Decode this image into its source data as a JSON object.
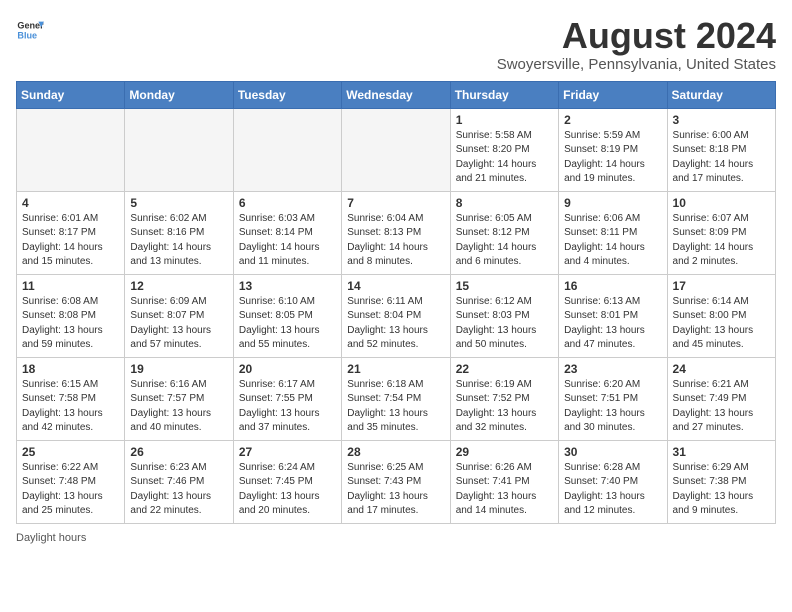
{
  "header": {
    "logo_line1": "General",
    "logo_line2": "Blue",
    "month_year": "August 2024",
    "location": "Swoyersville, Pennsylvania, United States"
  },
  "columns": [
    "Sunday",
    "Monday",
    "Tuesday",
    "Wednesday",
    "Thursday",
    "Friday",
    "Saturday"
  ],
  "weeks": [
    [
      {
        "day": "",
        "info": ""
      },
      {
        "day": "",
        "info": ""
      },
      {
        "day": "",
        "info": ""
      },
      {
        "day": "",
        "info": ""
      },
      {
        "day": "1",
        "info": "Sunrise: 5:58 AM\nSunset: 8:20 PM\nDaylight: 14 hours and 21 minutes."
      },
      {
        "day": "2",
        "info": "Sunrise: 5:59 AM\nSunset: 8:19 PM\nDaylight: 14 hours and 19 minutes."
      },
      {
        "day": "3",
        "info": "Sunrise: 6:00 AM\nSunset: 8:18 PM\nDaylight: 14 hours and 17 minutes."
      }
    ],
    [
      {
        "day": "4",
        "info": "Sunrise: 6:01 AM\nSunset: 8:17 PM\nDaylight: 14 hours and 15 minutes."
      },
      {
        "day": "5",
        "info": "Sunrise: 6:02 AM\nSunset: 8:16 PM\nDaylight: 14 hours and 13 minutes."
      },
      {
        "day": "6",
        "info": "Sunrise: 6:03 AM\nSunset: 8:14 PM\nDaylight: 14 hours and 11 minutes."
      },
      {
        "day": "7",
        "info": "Sunrise: 6:04 AM\nSunset: 8:13 PM\nDaylight: 14 hours and 8 minutes."
      },
      {
        "day": "8",
        "info": "Sunrise: 6:05 AM\nSunset: 8:12 PM\nDaylight: 14 hours and 6 minutes."
      },
      {
        "day": "9",
        "info": "Sunrise: 6:06 AM\nSunset: 8:11 PM\nDaylight: 14 hours and 4 minutes."
      },
      {
        "day": "10",
        "info": "Sunrise: 6:07 AM\nSunset: 8:09 PM\nDaylight: 14 hours and 2 minutes."
      }
    ],
    [
      {
        "day": "11",
        "info": "Sunrise: 6:08 AM\nSunset: 8:08 PM\nDaylight: 13 hours and 59 minutes."
      },
      {
        "day": "12",
        "info": "Sunrise: 6:09 AM\nSunset: 8:07 PM\nDaylight: 13 hours and 57 minutes."
      },
      {
        "day": "13",
        "info": "Sunrise: 6:10 AM\nSunset: 8:05 PM\nDaylight: 13 hours and 55 minutes."
      },
      {
        "day": "14",
        "info": "Sunrise: 6:11 AM\nSunset: 8:04 PM\nDaylight: 13 hours and 52 minutes."
      },
      {
        "day": "15",
        "info": "Sunrise: 6:12 AM\nSunset: 8:03 PM\nDaylight: 13 hours and 50 minutes."
      },
      {
        "day": "16",
        "info": "Sunrise: 6:13 AM\nSunset: 8:01 PM\nDaylight: 13 hours and 47 minutes."
      },
      {
        "day": "17",
        "info": "Sunrise: 6:14 AM\nSunset: 8:00 PM\nDaylight: 13 hours and 45 minutes."
      }
    ],
    [
      {
        "day": "18",
        "info": "Sunrise: 6:15 AM\nSunset: 7:58 PM\nDaylight: 13 hours and 42 minutes."
      },
      {
        "day": "19",
        "info": "Sunrise: 6:16 AM\nSunset: 7:57 PM\nDaylight: 13 hours and 40 minutes."
      },
      {
        "day": "20",
        "info": "Sunrise: 6:17 AM\nSunset: 7:55 PM\nDaylight: 13 hours and 37 minutes."
      },
      {
        "day": "21",
        "info": "Sunrise: 6:18 AM\nSunset: 7:54 PM\nDaylight: 13 hours and 35 minutes."
      },
      {
        "day": "22",
        "info": "Sunrise: 6:19 AM\nSunset: 7:52 PM\nDaylight: 13 hours and 32 minutes."
      },
      {
        "day": "23",
        "info": "Sunrise: 6:20 AM\nSunset: 7:51 PM\nDaylight: 13 hours and 30 minutes."
      },
      {
        "day": "24",
        "info": "Sunrise: 6:21 AM\nSunset: 7:49 PM\nDaylight: 13 hours and 27 minutes."
      }
    ],
    [
      {
        "day": "25",
        "info": "Sunrise: 6:22 AM\nSunset: 7:48 PM\nDaylight: 13 hours and 25 minutes."
      },
      {
        "day": "26",
        "info": "Sunrise: 6:23 AM\nSunset: 7:46 PM\nDaylight: 13 hours and 22 minutes."
      },
      {
        "day": "27",
        "info": "Sunrise: 6:24 AM\nSunset: 7:45 PM\nDaylight: 13 hours and 20 minutes."
      },
      {
        "day": "28",
        "info": "Sunrise: 6:25 AM\nSunset: 7:43 PM\nDaylight: 13 hours and 17 minutes."
      },
      {
        "day": "29",
        "info": "Sunrise: 6:26 AM\nSunset: 7:41 PM\nDaylight: 13 hours and 14 minutes."
      },
      {
        "day": "30",
        "info": "Sunrise: 6:28 AM\nSunset: 7:40 PM\nDaylight: 13 hours and 12 minutes."
      },
      {
        "day": "31",
        "info": "Sunrise: 6:29 AM\nSunset: 7:38 PM\nDaylight: 13 hours and 9 minutes."
      }
    ]
  ],
  "footer": "Daylight hours"
}
